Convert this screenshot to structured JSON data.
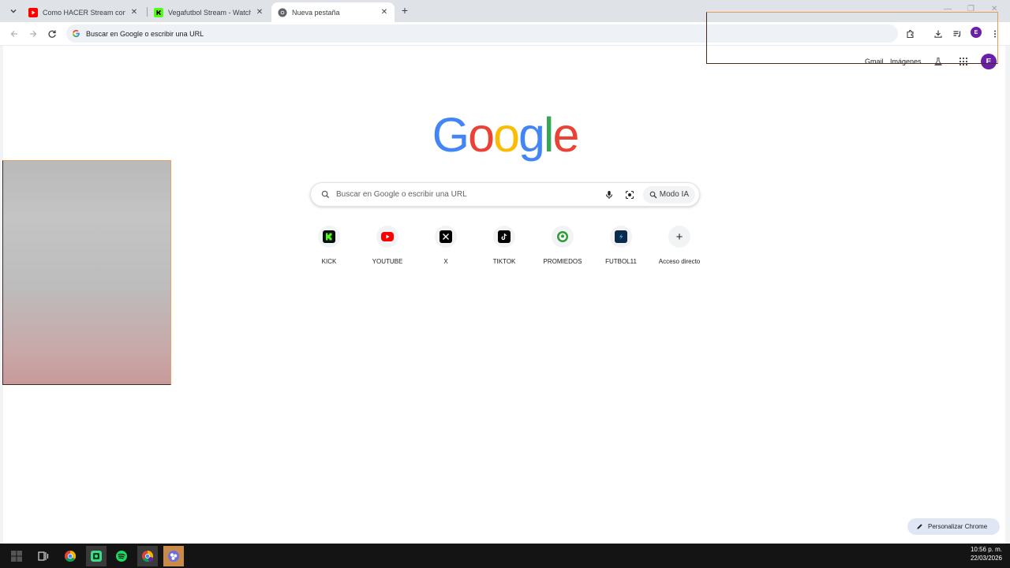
{
  "browser": {
    "tabs": [
      {
        "title": "Como HACER Stream con el Pr",
        "favicon": "youtube-icon",
        "active": false
      },
      {
        "title": "Vegafutbol Stream - Watch Live",
        "favicon": "kick-icon",
        "active": false
      },
      {
        "title": "Nueva pestaña",
        "favicon": "chrome-icon",
        "active": true
      }
    ],
    "omnibox_placeholder": "Buscar en Google o escribir una URL",
    "profile_initial": "E"
  },
  "page": {
    "top_links": {
      "gmail": "Gmail",
      "images": "Imágenes"
    },
    "avatar_initial": "E",
    "logo_letters": [
      "G",
      "o",
      "o",
      "g",
      "l",
      "e"
    ],
    "logo_colors": [
      "#4285F4",
      "#EA4335",
      "#FBBC05",
      "#4285F4",
      "#34A853",
      "#EA4335"
    ],
    "search_placeholder": "Buscar en Google o escribir una URL",
    "ai_mode_label": "Modo IA",
    "shortcuts": [
      {
        "label": "KICK",
        "icon": "kick-icon"
      },
      {
        "label": "YOUTUBE",
        "icon": "youtube-icon"
      },
      {
        "label": "X",
        "icon": "x-icon"
      },
      {
        "label": "TIKTOK",
        "icon": "tiktok-icon"
      },
      {
        "label": "PROMIEDOS",
        "icon": "promiedos-icon"
      },
      {
        "label": "FUTBOL11",
        "icon": "futbol11-icon"
      },
      {
        "label": "Acceso directo",
        "icon": "plus-icon"
      }
    ],
    "customize_label": "Personalizar Chrome"
  },
  "taskbar": {
    "apps": [
      "windows-start-icon",
      "task-view-icon",
      "chrome-icon",
      "app-icon",
      "spotify-icon",
      "chrome-profile-icon",
      "obs-icon"
    ],
    "time": "10:56 p. m.",
    "date": "22/03/2026"
  },
  "colors": {
    "accent_profile": "#6a1fa8",
    "kick_green": "#53fc18",
    "youtube_red": "#ff0000",
    "highlight_border": "#e89a52"
  }
}
